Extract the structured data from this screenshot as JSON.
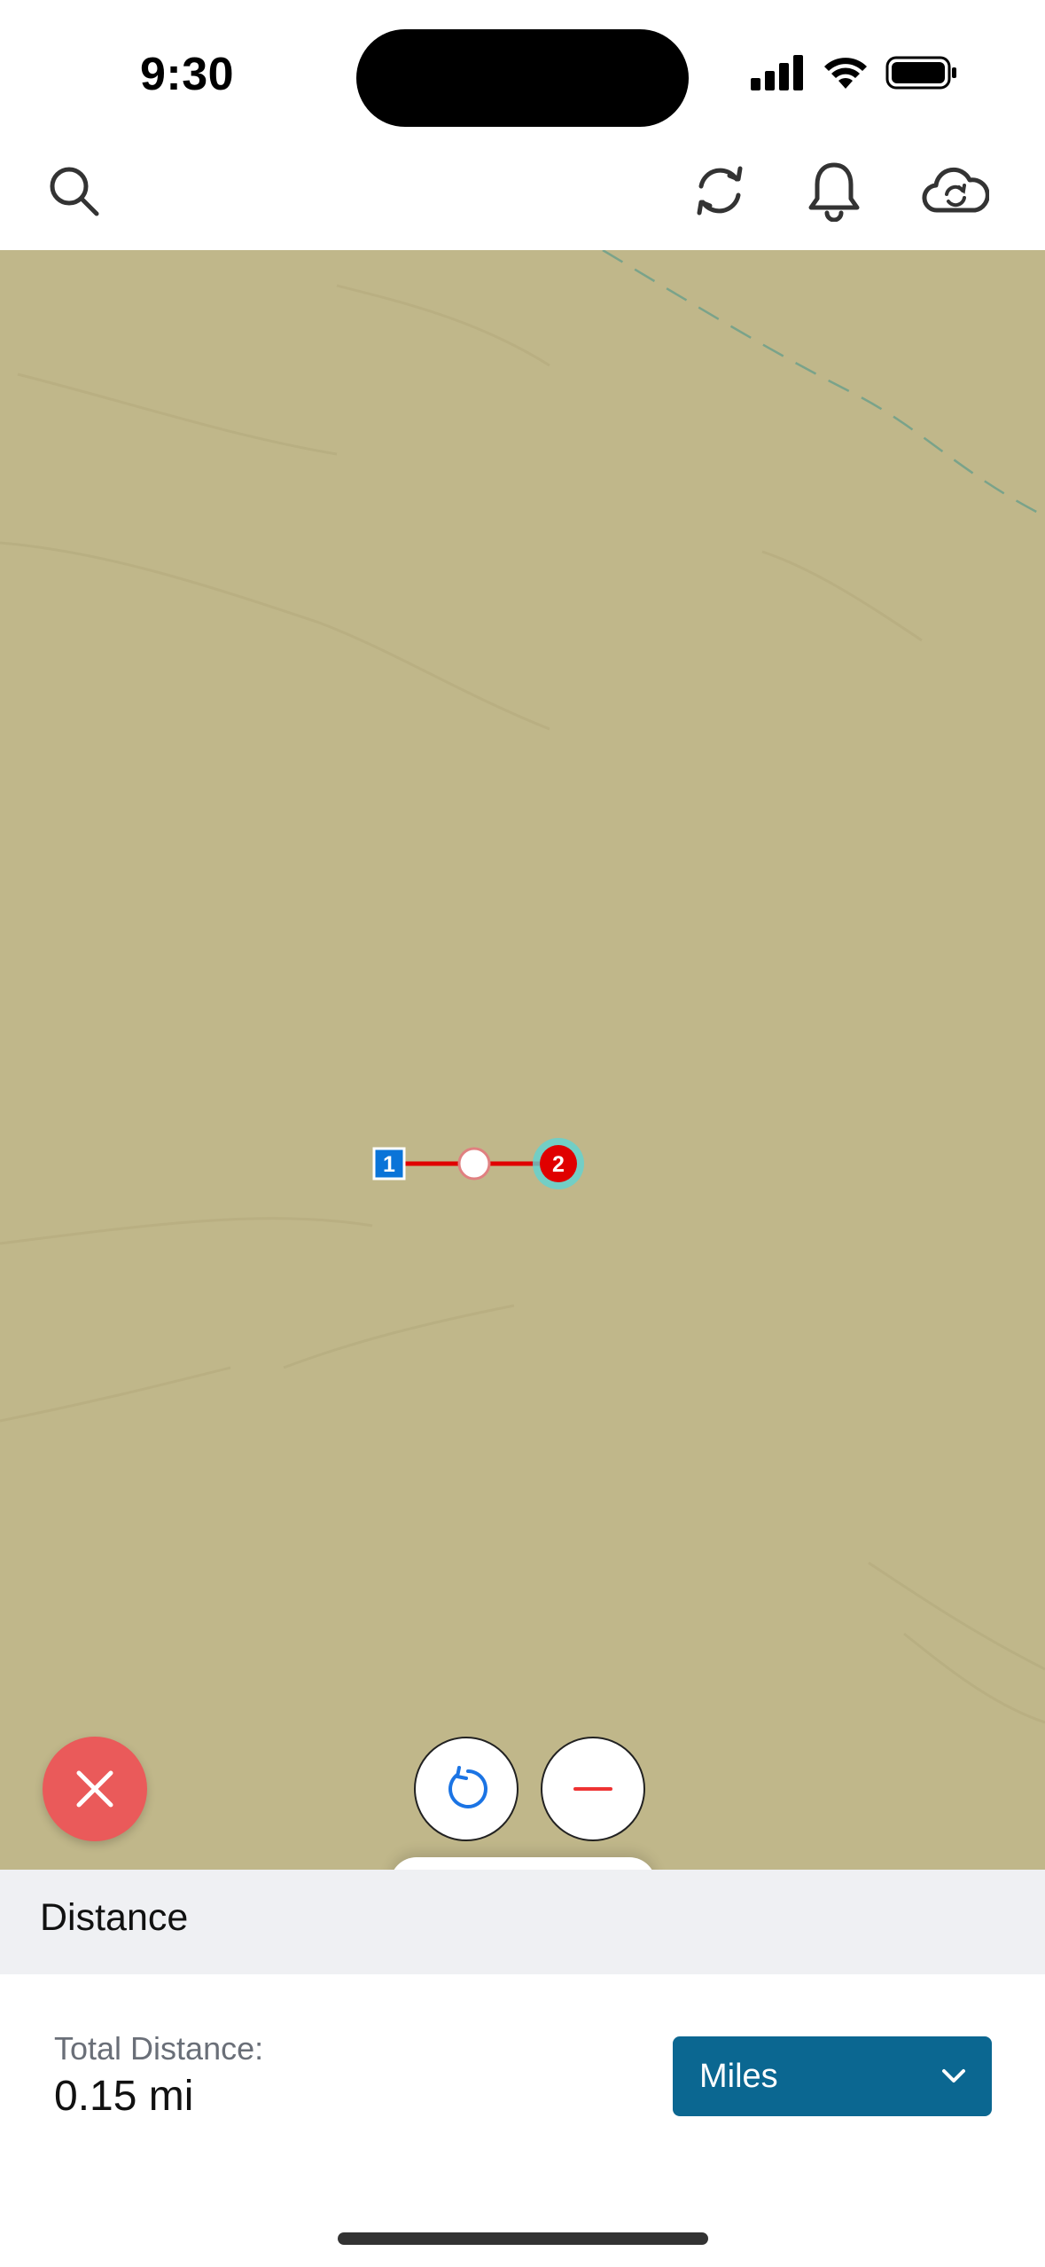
{
  "status_bar": {
    "time": "9:30"
  },
  "header": {
    "icons": [
      "search-icon",
      "sync-icon",
      "bell-icon",
      "cloud-sync-icon"
    ]
  },
  "map": {
    "background_color": "#c0b78a",
    "route": {
      "line_color": "#e00000",
      "start_marker": "1",
      "end_marker": "2",
      "start_marker_color": "#0a74d8",
      "end_marker_color": "#e00000",
      "selected_halo_color": "#5fd3d3"
    }
  },
  "controls": {
    "close_icon": "close-icon",
    "undo_icon": "undo-icon",
    "minus_icon": "minus-icon",
    "close_color": "#ea5a5a"
  },
  "panel": {
    "title": "Distance",
    "total_distance_label": "Total Distance:",
    "total_distance_value": "0.15 mi",
    "units_select": {
      "selected": "Miles",
      "color": "#0b6791"
    }
  }
}
